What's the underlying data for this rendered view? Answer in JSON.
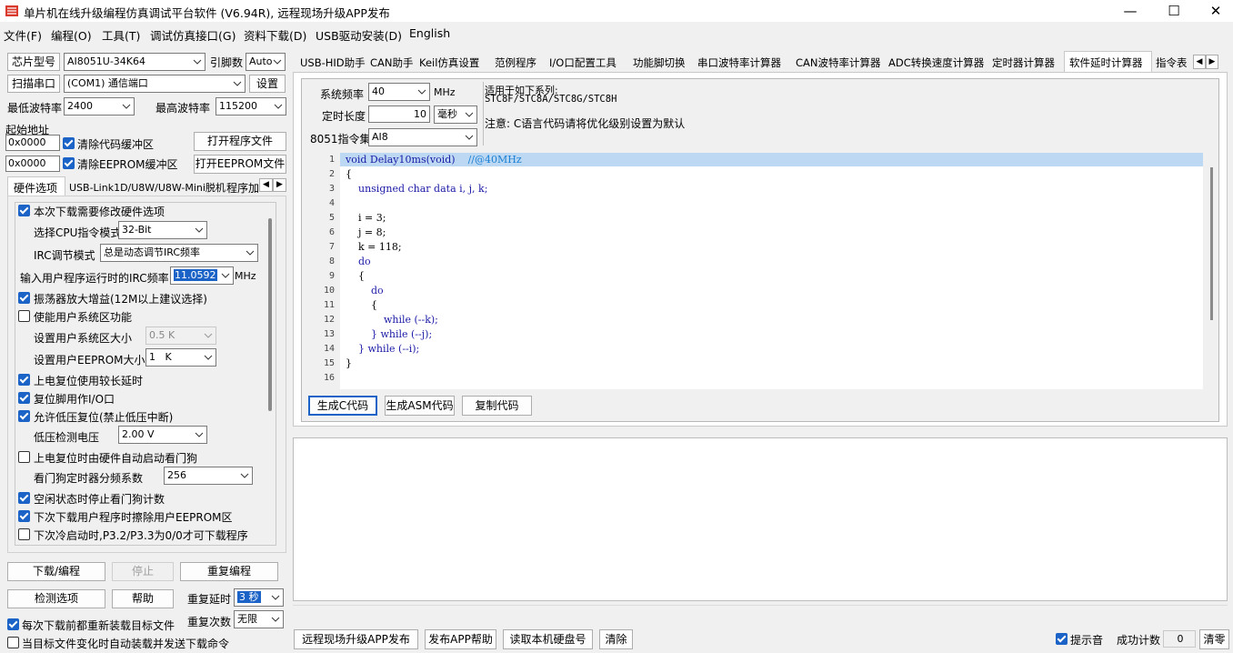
{
  "window": {
    "title": "单片机在线升级编程仿真调试平台软件 (V6.94R), 远程现场升级APP发布",
    "minimize": "—",
    "maximize": "☐",
    "close": "✕"
  },
  "menu": [
    "文件(F)",
    "编程(O)",
    "工具(T)",
    "调试仿真接口(G)",
    "资料下载(D)",
    "USB驱动安装(D)",
    "English"
  ],
  "left": {
    "chip_label": "芯片型号",
    "chip_value": "AI8051U-34K64",
    "pins_label": "引脚数",
    "pins_value": "Auto",
    "scan_port_button": "扫描串口",
    "port_value": "(COM1) 通信端口",
    "settings_button": "设置",
    "min_baud_label": "最低波特率",
    "min_baud_value": "2400",
    "max_baud_label": "最高波特率",
    "max_baud_value": "115200",
    "start_addr_label": "起始地址",
    "addr1_value": "0x0000",
    "clear_code_label": "清除代码缓冲区",
    "open_program_button": "打开程序文件",
    "addr2_value": "0x0000",
    "clear_eeprom_label": "清除EEPROM缓冲区",
    "open_eeprom_button": "打开EEPROM文件",
    "tabs": [
      "硬件选项",
      "USB-Link1D/U8W/U8W-Mini脱机",
      "程序加"
    ],
    "options": {
      "modify_hw": "本次下载需要修改硬件选项",
      "cpu_mode_label": "选择CPU指令模式",
      "cpu_mode_value": "32-Bit",
      "irc_mode_label": "IRC调节模式",
      "irc_mode_value": "总是动态调节IRC频率",
      "irc_freq_label": "输入用户程序运行时的IRC频率",
      "irc_freq_value": "11.0592",
      "irc_freq_unit": "MHz",
      "osc_gain": "振荡器放大增益(12M以上建议选择)",
      "enable_sys_area": "使能用户系统区功能",
      "sys_area_size_label": "设置用户系统区大小",
      "sys_area_size_value": "0.5 K",
      "eeprom_size_label": "设置用户EEPROM大小",
      "eeprom_size_value": "1   K",
      "long_reset_delay": "上电复位使用较长延时",
      "reset_as_io": "复位脚用作I/O口",
      "low_voltage_reset": "允许低压复位(禁止低压中断)",
      "lv_detect_label": "低压检测电压",
      "lv_detect_value": "2.00 V",
      "hw_watchdog": "上电复位时由硬件自动启动看门狗",
      "wdt_div_label": "看门狗定时器分频系数",
      "wdt_div_value": "256",
      "idle_stop_wdt": "空闲状态时停止看门狗计数",
      "erase_eeprom": "下次下载用户程序时擦除用户EEPROM区",
      "p32_p33": "下次冷启动时,P3.2/P3.3为0/0才可下载程序"
    },
    "download_button": "下载/编程",
    "stop_button": "停止",
    "reprogram_button": "重复编程",
    "check_options_button": "检测选项",
    "help_button": "帮助",
    "repeat_delay_label": "重复延时",
    "repeat_delay_value": "3 秒",
    "repeat_count_label": "重复次数",
    "repeat_count_value": "无限",
    "reload_each": "每次下载前都重新装载目标文件",
    "auto_reload": "当目标文件变化时自动装载并发送下载命令"
  },
  "right": {
    "tabs": [
      "USB-HID助手",
      "CAN助手",
      "Keil仿真设置",
      "范例程序",
      "I/O口配置工具",
      "功能脚切换",
      "串口波特率计算器",
      "CAN波特率计算器",
      "ADC转换速度计算器",
      "定时器计算器",
      "软件延时计算器",
      "指令表"
    ],
    "sys_freq_label": "系统频率",
    "sys_freq_value": "40",
    "sys_freq_unit": "MHz",
    "delay_len_label": "定时长度",
    "delay_len_value": "10",
    "delay_unit_value": "毫秒",
    "isa_label": "8051指令集",
    "isa_value": "AI8",
    "applies_label": "适用于如下系列:",
    "applies_series": "STC8F/STC8A/STC8G/STC8H",
    "note": "注意: C语言代码请将优化级别设置为默认",
    "code_lines": [
      "void Delay10ms(void)    //@40MHz",
      "{",
      "    unsigned char data i, j, k;",
      "",
      "    i = 3;",
      "    j = 8;",
      "    k = 118;",
      "    do",
      "    {",
      "        do",
      "        {",
      "            while (--k);",
      "        } while (--j);",
      "    } while (--i);",
      "}",
      ""
    ],
    "line_numbers": [
      "1",
      "2",
      "3",
      "4",
      "5",
      "6",
      "7",
      "8",
      "9",
      "10",
      "11",
      "12",
      "13",
      "14",
      "15",
      "16"
    ],
    "gen_c_button": "生成C代码",
    "gen_asm_button": "生成ASM代码",
    "copy_code_button": "复制代码",
    "publish_app_button": "远程现场升级APP发布",
    "app_help_button": "发布APP帮助",
    "read_disk_button": "读取本机硬盘号",
    "clear_button": "清除",
    "beep_label": "提示音",
    "success_count_label": "成功计数",
    "success_count_value": "0",
    "reset_count_button": "清零"
  },
  "colors": {
    "accent": "#1b63c6",
    "code_highlight": "#bcd8f2",
    "keyword": "#1a1aa6",
    "comment": "#1a7fd4"
  }
}
